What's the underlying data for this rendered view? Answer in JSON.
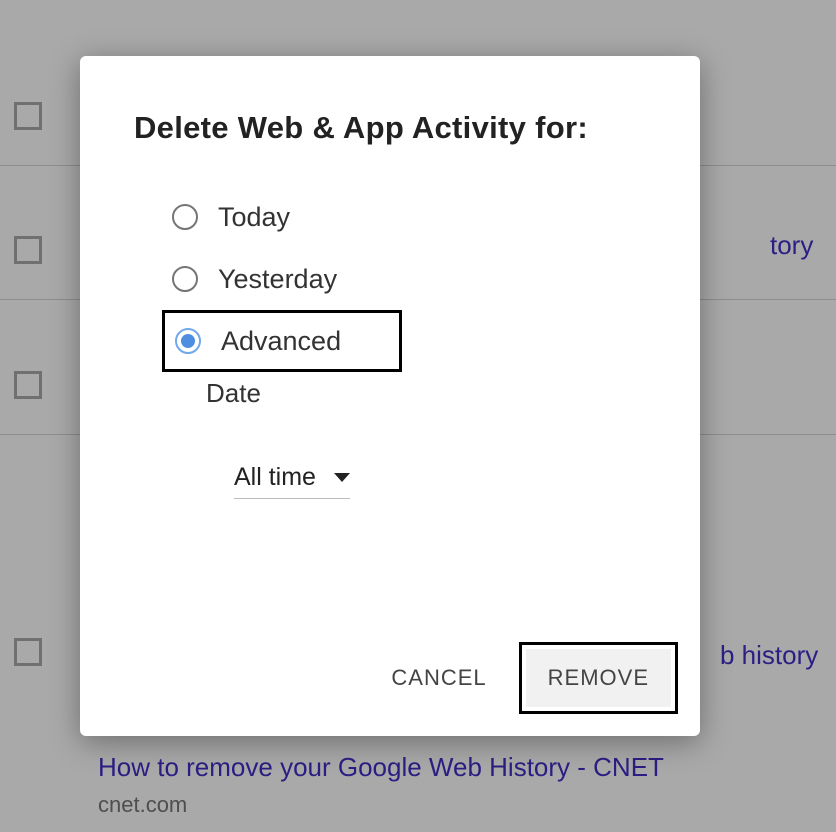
{
  "dialog": {
    "title": "Delete Web & App Activity for:",
    "options": {
      "today": "Today",
      "yesterday": "Yesterday",
      "advanced": "Advanced"
    },
    "date_sublabel": "Date",
    "dropdown_value": "All time",
    "actions": {
      "cancel": "CANCEL",
      "remove": "REMOVE"
    }
  },
  "background": {
    "link_fragment_1": "tory",
    "link_fragment_2": "b history",
    "result_title": "How to remove your Google Web History - CNET",
    "result_domain": "cnet.com"
  }
}
